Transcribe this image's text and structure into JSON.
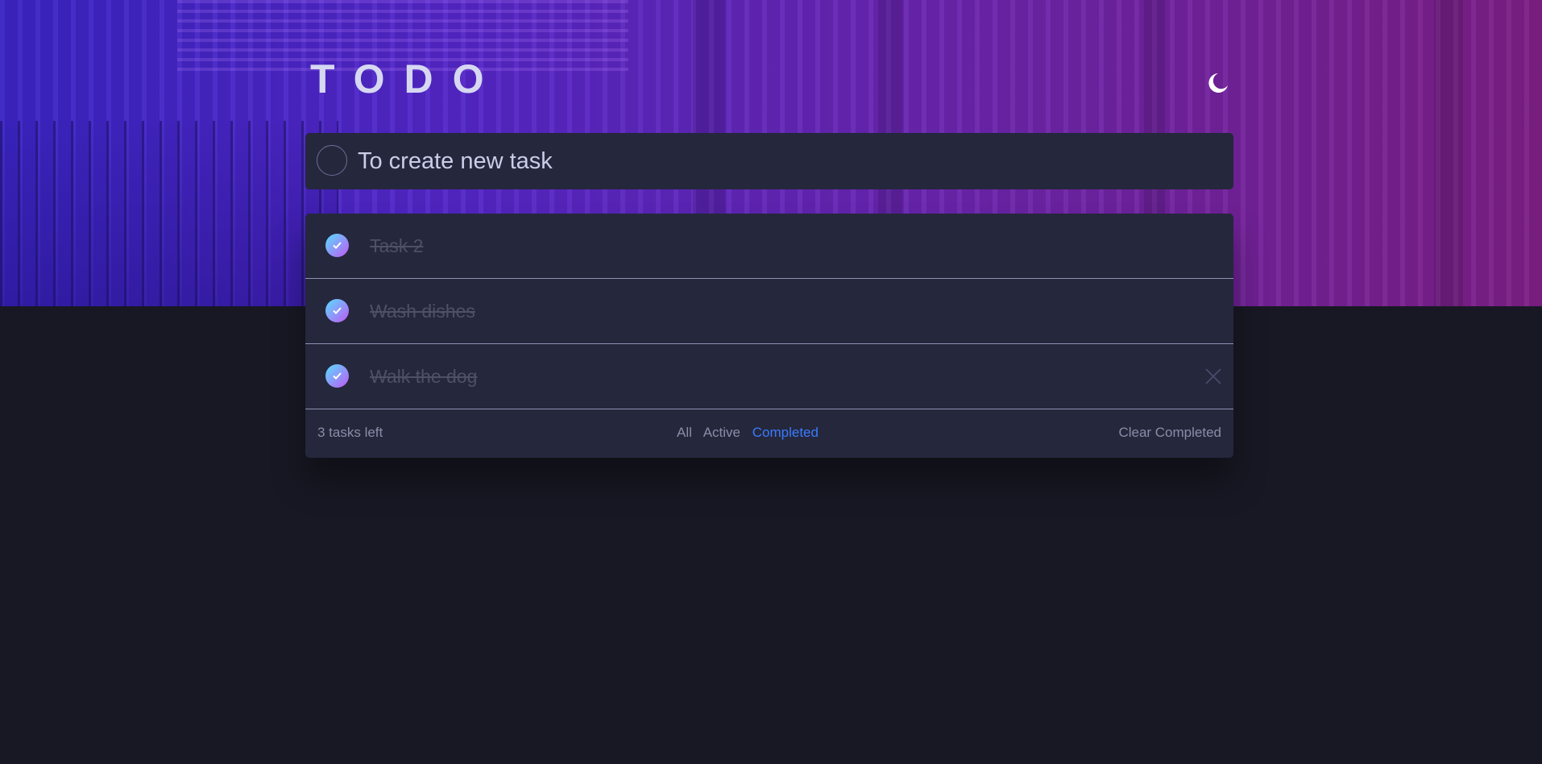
{
  "app": {
    "title": "TODO",
    "theme_toggle_icon": "moon-icon"
  },
  "new_task": {
    "placeholder": "To create new task",
    "value": ""
  },
  "tasks": [
    {
      "text": "Task 2",
      "completed": true
    },
    {
      "text": "Wash dishes",
      "completed": true
    },
    {
      "text": "Walk the dog",
      "completed": true
    }
  ],
  "footer": {
    "count_label": "3 tasks left",
    "filters": [
      "All",
      "Active",
      "Completed"
    ],
    "active_filter": "Completed",
    "clear_label": "Clear Completed"
  },
  "colors": {
    "page_bg": "#181824",
    "card_bg": "#25273c",
    "accent": "#3a7bfd",
    "check_gradient_start": "#57ddff",
    "check_gradient_end": "#c058f3"
  }
}
